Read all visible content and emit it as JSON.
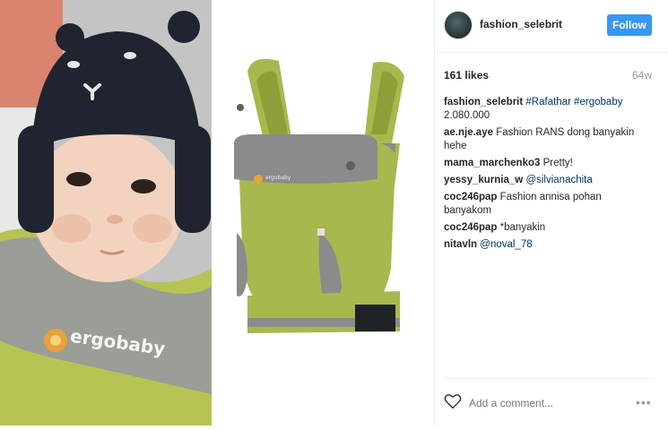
{
  "post": {
    "image_brand_text": "ergobaby",
    "carrier_logo_text": "ergobaby"
  },
  "header": {
    "username": "fashion_selebrit",
    "follow_label": "Follow"
  },
  "meta": {
    "likes": "161 likes",
    "age": "64w"
  },
  "comments": [
    {
      "user": "fashion_selebrit",
      "parts": [
        {
          "type": "tag",
          "text": "#Rafathar"
        },
        {
          "type": "text",
          "text": " "
        },
        {
          "type": "tag",
          "text": "#ergobaby"
        },
        {
          "type": "text",
          "text": " 2.080.000"
        }
      ]
    },
    {
      "user": "ae.nje.aye",
      "parts": [
        {
          "type": "text",
          "text": "Fashion RANS dong banyakin hehe"
        }
      ]
    },
    {
      "user": "mama_marchenko3",
      "parts": [
        {
          "type": "text",
          "text": "Pretty!"
        }
      ]
    },
    {
      "user": "yessy_kurnia_w",
      "parts": [
        {
          "type": "tag",
          "text": "@silvianachita"
        }
      ]
    },
    {
      "user": "coc246pap",
      "parts": [
        {
          "type": "text",
          "text": "Fashion annisa pohan banyakom"
        }
      ]
    },
    {
      "user": "coc246pap",
      "parts": [
        {
          "type": "text",
          "text": "*banyakin"
        }
      ]
    },
    {
      "user": "nitavln",
      "parts": [
        {
          "type": "tag",
          "text": "@noval_78"
        }
      ]
    }
  ],
  "footer": {
    "add_comment_placeholder": "Add a comment...",
    "more_glyph": "•••"
  },
  "colors": {
    "accent": "#3897f0",
    "hashtag": "#003569",
    "carrier_green": "#a7b84f",
    "carrier_gray": "#8b8b8b"
  },
  "icons": [
    "heart-icon",
    "more-options-icon"
  ]
}
